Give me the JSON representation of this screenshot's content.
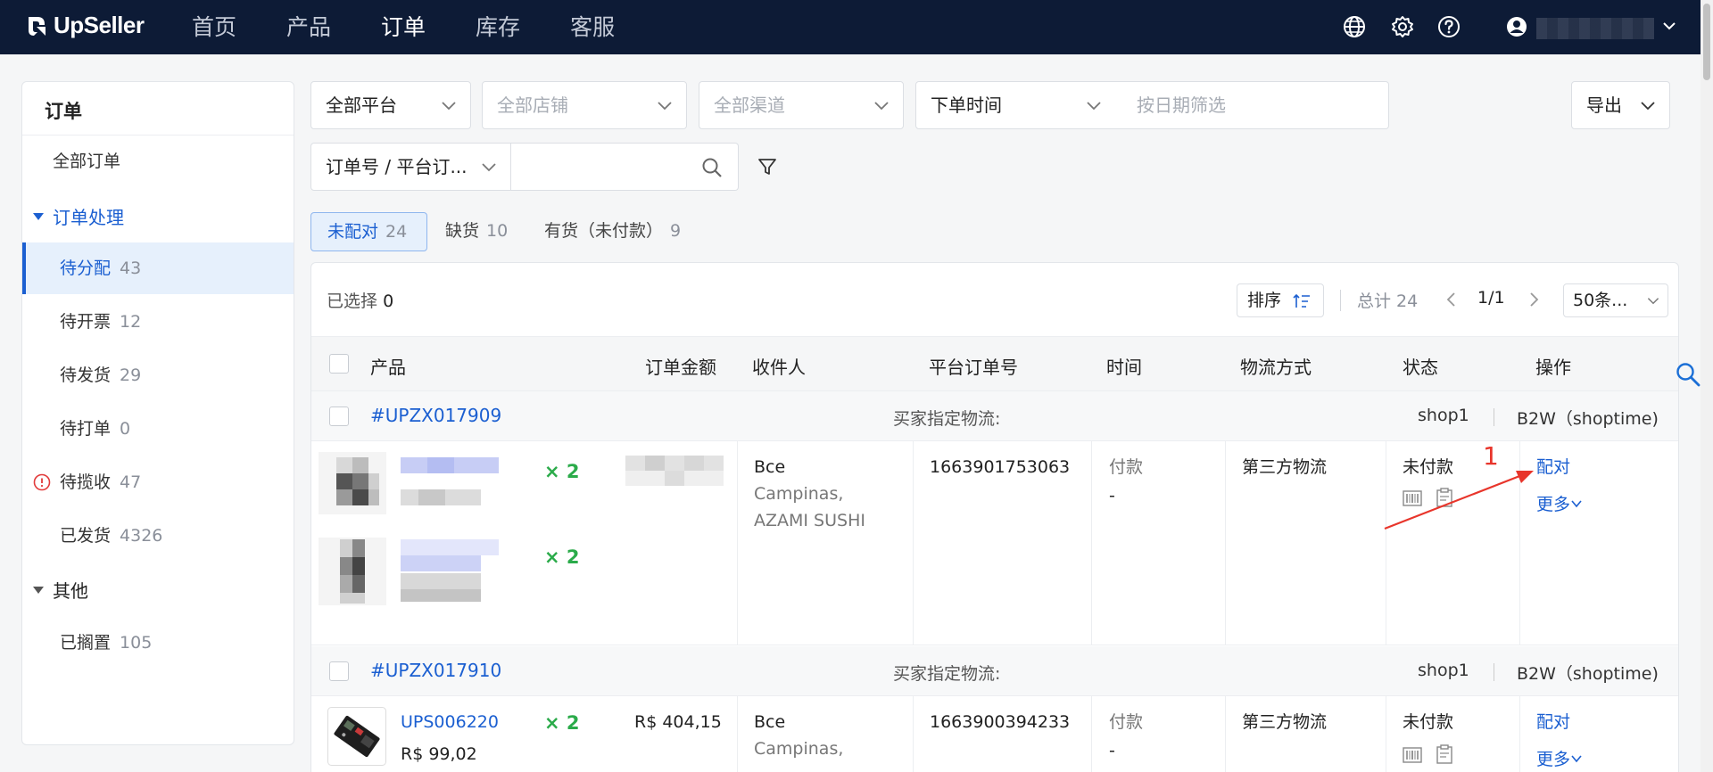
{
  "brand": {
    "name": "UpSeller"
  },
  "nav": {
    "items": [
      "首页",
      "产品",
      "订单",
      "库存",
      "客服"
    ],
    "active_index": 2
  },
  "sidebar": {
    "title": "订单",
    "all_orders": "全部订单",
    "group_processing": "订单处理",
    "items": [
      {
        "label": "待分配",
        "count": "43"
      },
      {
        "label": "待开票",
        "count": "12"
      },
      {
        "label": "待发货",
        "count": "29"
      },
      {
        "label": "待打单",
        "count": "0"
      },
      {
        "label": "待揽收",
        "count": "47"
      },
      {
        "label": "已发货",
        "count": "4326"
      }
    ],
    "group_other": "其他",
    "other_items": [
      {
        "label": "已搁置",
        "count": "105"
      }
    ]
  },
  "filters": {
    "platform": "全部平台",
    "store": "全部店铺",
    "channel": "全部渠道",
    "time_type": "下单时间",
    "date_placeholder": "按日期筛选",
    "export": "导出",
    "search_field": "订单号 / 平台订...",
    "search_value": ""
  },
  "tabs": [
    {
      "label": "未配对",
      "count": "24"
    },
    {
      "label": "缺货",
      "count": "10"
    },
    {
      "label": "有货（未付款）",
      "count": "9"
    }
  ],
  "toolbar": {
    "selected_label": "已选择",
    "selected_count": "0",
    "sort_label": "排序",
    "total_label": "总计 24",
    "page": "1/1",
    "page_size": "50条..."
  },
  "table": {
    "headers": [
      "产品",
      "订单金额",
      "收件人",
      "平台订单号",
      "时间",
      "物流方式",
      "状态",
      "操作"
    ],
    "orders": [
      {
        "order_no": "#UPZX017909",
        "buyer_logistics": "买家指定物流:",
        "shop": "shop1",
        "channel": "B2W（shoptime)",
        "products": [
          {
            "qty": "× 2"
          },
          {
            "qty": "× 2"
          }
        ],
        "recipient_name": "Bce",
        "recipient_city": "Campinas,",
        "recipient_addr": "AZAMI SUSHI",
        "platform_order": "1663901753063",
        "time_label": "付款",
        "time_value": "-",
        "logistics": "第三方物流",
        "status": "未付款",
        "action_pair": "配对",
        "action_more": "更多",
        "annotation": "1"
      },
      {
        "order_no": "#UPZX017910",
        "buyer_logistics": "买家指定物流:",
        "shop": "shop1",
        "channel": "B2W（shoptime)",
        "product_sku": "UPS006220",
        "product_price": "R$ 99,02",
        "qty": "× 2",
        "amount": "R$ 404,15",
        "recipient_name": "Bce",
        "recipient_city": "Campinas,",
        "platform_order": "1663900394233",
        "time_label": "付款",
        "time_value": "-",
        "logistics": "第三方物流",
        "status": "未付款",
        "action_pair": "配对",
        "action_more": "更多"
      }
    ]
  },
  "colors": {
    "nav_bg": "#0d1b36",
    "accent": "#1b5fd1",
    "qty_green": "#2bab4a",
    "annotation_red": "#e8352b"
  }
}
